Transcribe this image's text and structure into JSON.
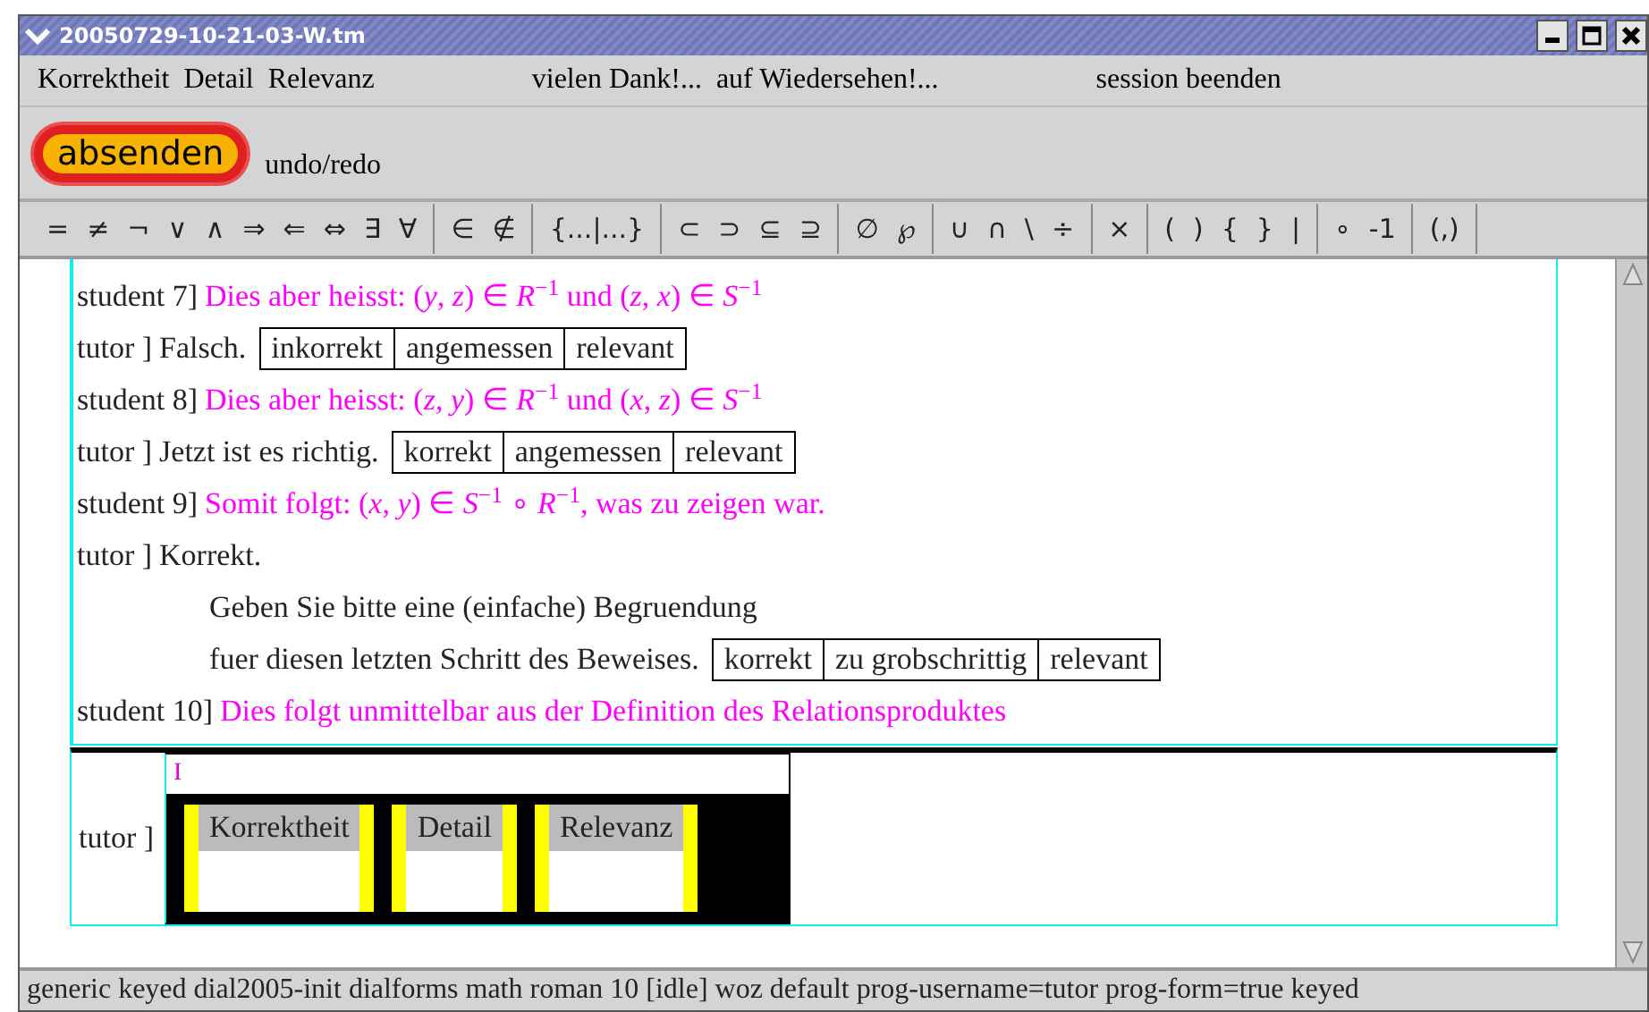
{
  "window": {
    "title": "20050729-10-21-03-W.tm"
  },
  "menu": [
    "Korrektheit",
    "Detail",
    "Relevanz",
    "vielen Dank!...",
    "auf Wiedersehen!...",
    "session beenden"
  ],
  "toolbar": {
    "send_button": "absenden",
    "undo": "undo/redo"
  },
  "symbol_groups": [
    [
      "=",
      "≠",
      "¬",
      "∨",
      "∧",
      "⇒",
      "⇐",
      "⇔",
      "∃",
      "∀"
    ],
    [
      "∈",
      "∉"
    ],
    [
      "{...|...}"
    ],
    [
      "⊂",
      "⊃",
      "⊆",
      "⊇"
    ],
    [
      "∅",
      "℘"
    ],
    [
      "∪",
      "∩",
      "\\",
      "÷"
    ],
    [
      "×"
    ],
    [
      "(",
      ")",
      "{",
      "}",
      "|"
    ],
    [
      "∘",
      "-1"
    ],
    [
      "(,)"
    ]
  ],
  "dialog": [
    {
      "kind": "student",
      "speaker": "student 7]",
      "lines": [
        "Dies aber heisst: (*y*, *z*) ∈ *R*$^{−1}$ und (*z*, *x*) ∈ *S*$^{−1}$"
      ]
    },
    {
      "kind": "tutor",
      "speaker": "tutor ]",
      "lines": [
        "Falsch."
      ],
      "tags": [
        "inkorrekt",
        "angemessen",
        "relevant"
      ]
    },
    {
      "kind": "student",
      "speaker": "student 8]",
      "lines": [
        "Dies aber heisst: (*z*, *y*) ∈ *R*$^{−1}$ und (*x*, *z*) ∈ *S*$^{−1}$"
      ]
    },
    {
      "kind": "tutor",
      "speaker": "tutor ]",
      "lines": [
        "Jetzt ist es richtig."
      ],
      "tags": [
        "korrekt",
        "angemessen",
        "relevant"
      ]
    },
    {
      "kind": "student",
      "speaker": "student 9]",
      "lines": [
        "Somit folgt: (*x*, *y*) ∈ *S*$^{−1}$ ∘ *R*$^{−1}$, was zu zeigen war."
      ]
    },
    {
      "kind": "tutor",
      "speaker": "tutor ]",
      "lines": [
        "Korrekt.",
        "Geben Sie bitte eine (einfache) Begruendung",
        "fuer diesen letzten Schritt des Beweises."
      ],
      "tags": [
        "korrekt",
        "zu grobschrittig",
        "relevant"
      ]
    },
    {
      "kind": "student",
      "speaker": "student 10]",
      "lines": [
        "Dies folgt unmittelbar aus der Definition des Relationsproduktes"
      ]
    }
  ],
  "input": {
    "speaker": "tutor ]",
    "cursor": "I",
    "fields": [
      "Korrektheit",
      "Detail",
      "Relevanz"
    ]
  },
  "status_bar": "generic keyed dial2005-init dialforms math roman 10 [idle]  woz default prog-username=tutor prog-form=true keyed"
}
